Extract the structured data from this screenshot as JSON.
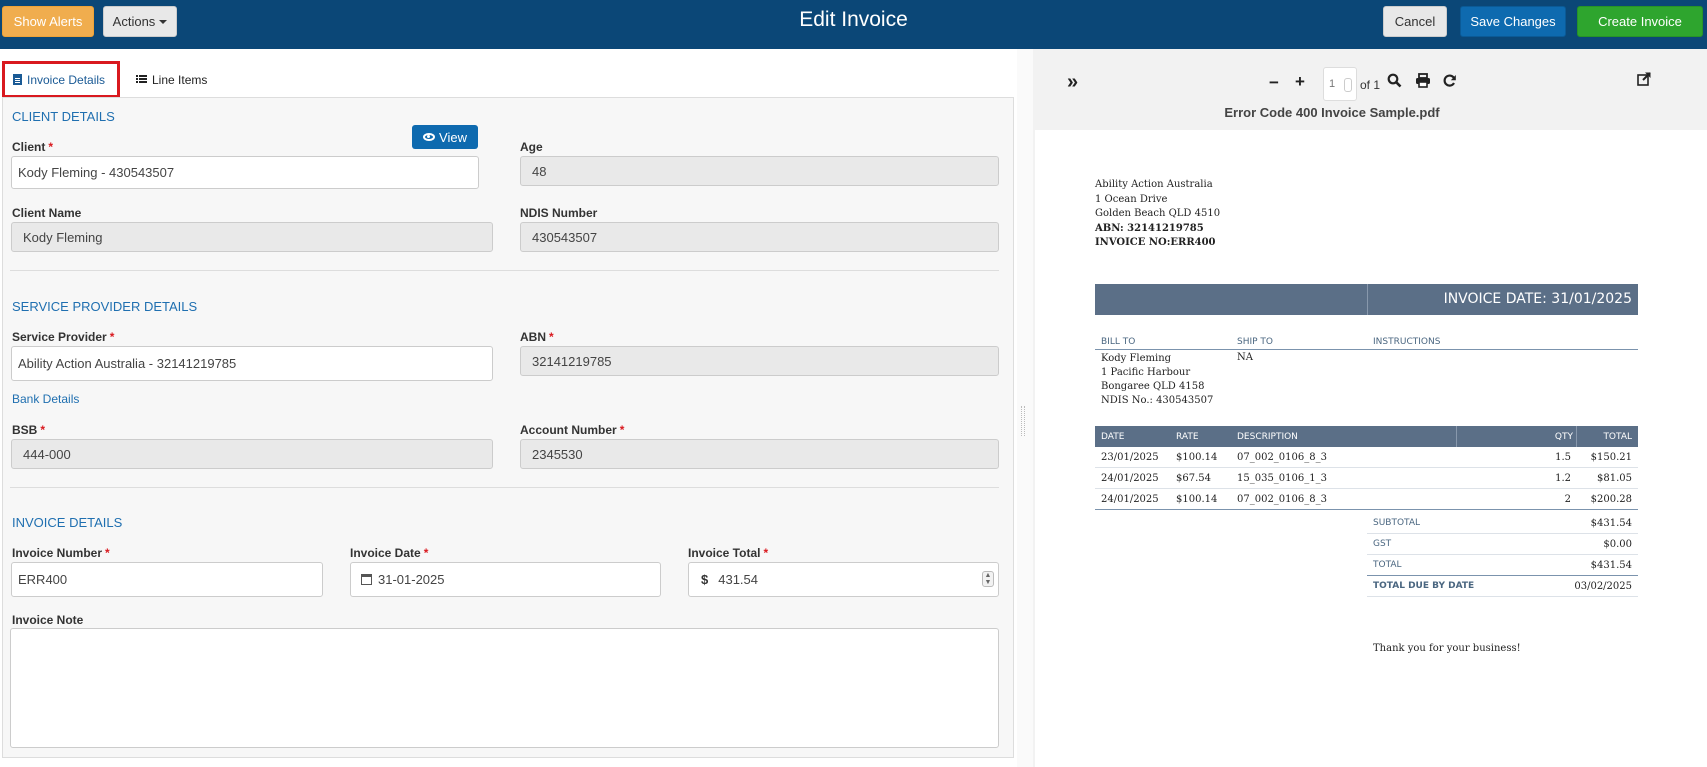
{
  "header": {
    "show_alerts": "Show Alerts",
    "actions": "Actions",
    "title": "Edit Invoice",
    "cancel": "Cancel",
    "save": "Save Changes",
    "create": "Create Invoice"
  },
  "tabs": [
    {
      "label": "Invoice Details",
      "icon": "file-text-icon",
      "active": true
    },
    {
      "label": "Line Items",
      "icon": "list-icon",
      "active": false
    }
  ],
  "client": {
    "section": "CLIENT DETAILS",
    "view_label": "View",
    "client_label": "Client",
    "client_value": "Kody Fleming - 430543507",
    "age_label": "Age",
    "age_value": "48",
    "name_label": "Client Name",
    "name_value": "Kody Fleming",
    "ndis_label": "NDIS Number",
    "ndis_value": "430543507"
  },
  "provider": {
    "section": "SERVICE PROVIDER DETAILS",
    "sp_label": "Service Provider",
    "sp_value": "Ability Action Australia - 32141219785",
    "abn_label": "ABN",
    "abn_value": "32141219785",
    "bank_label": "Bank Details",
    "bsb_label": "BSB",
    "bsb_value": "444-000",
    "acct_label": "Account Number",
    "acct_value": "2345530"
  },
  "invoice": {
    "section": "INVOICE DETAILS",
    "num_label": "Invoice Number",
    "num_value": "ERR400",
    "date_label": "Invoice Date",
    "date_value": "31-01-2025",
    "total_label": "Invoice Total",
    "currency": "$",
    "total_value": "431.54",
    "note_label": "Invoice Note",
    "note_value": ""
  },
  "viewer": {
    "page_current": "1",
    "page_of": "of 1",
    "file_name": "Error Code 400 Invoice Sample.pdf"
  },
  "pdf": {
    "from": {
      "name": "Ability Action Australia",
      "line1": "1 Ocean Drive",
      "line2": "Golden Beach QLD 4510",
      "abn": "ABN: 32141219785",
      "invno": "INVOICE NO:ERR400"
    },
    "invoice_date": "INVOICE DATE: 31/01/2025",
    "bill_to_head": "BILL TO",
    "ship_to_head": "SHIP TO",
    "instructions_head": "INSTRUCTIONS",
    "bill_to": {
      "name": "Kody Fleming",
      "line1": "1 Pacific Harbour",
      "line2": "Bongaree QLD 4158",
      "ndis": "NDIS No.: 430543507"
    },
    "ship_to": "NA",
    "columns": {
      "date": "DATE",
      "rate": "RATE",
      "desc": "DESCRIPTION",
      "qty": "QTY",
      "total": "TOTAL"
    },
    "rows": [
      {
        "date": "23/01/2025",
        "rate": "$100.14",
        "desc": "07_002_0106_8_3",
        "qty": "1.5",
        "total": "$150.21"
      },
      {
        "date": "24/01/2025",
        "rate": "$67.54",
        "desc": "15_035_0106_1_3",
        "qty": "1.2",
        "total": "$81.05"
      },
      {
        "date": "24/01/2025",
        "rate": "$100.14",
        "desc": "07_002_0106_8_3",
        "qty": "2",
        "total": "$200.28"
      }
    ],
    "totals": [
      {
        "label": "SUBTOTAL",
        "value": "$431.54"
      },
      {
        "label": "GST",
        "value": "$0.00"
      },
      {
        "label": "TOTAL",
        "value": "$431.54"
      },
      {
        "label": "TOTAL DUE BY DATE",
        "value": "03/02/2025"
      }
    ],
    "thanks": "Thank you for your business!"
  }
}
